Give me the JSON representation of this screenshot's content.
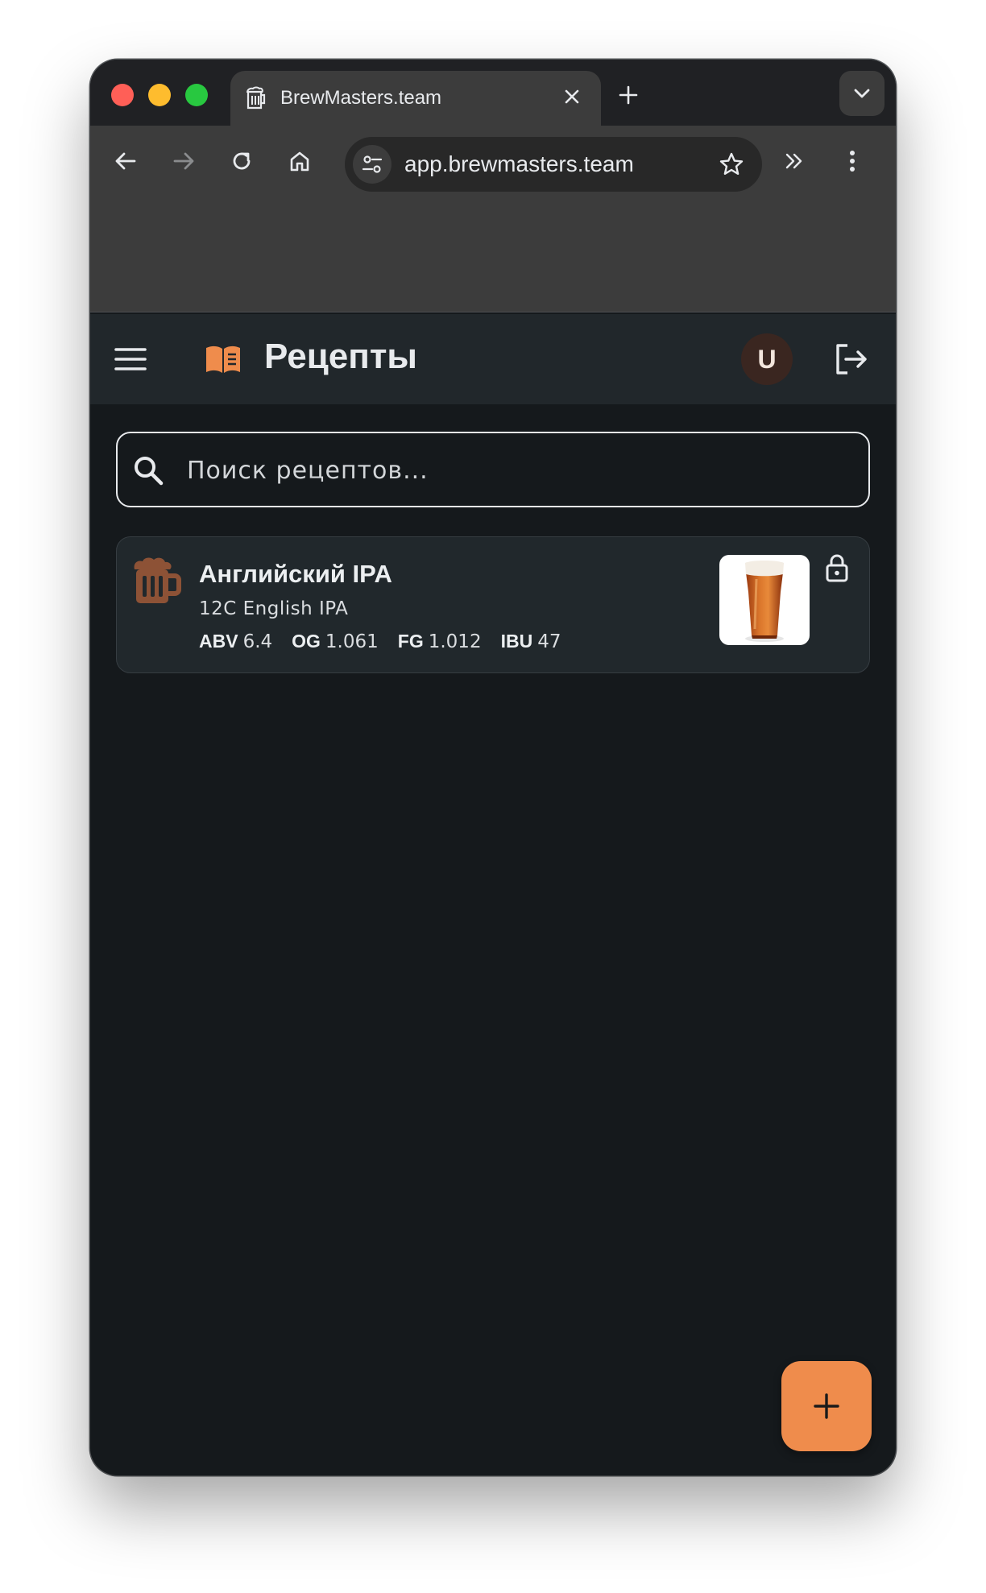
{
  "browser": {
    "tab_title": "BrewMasters.team",
    "url": "app.brewmasters.team"
  },
  "header": {
    "title": "Рецепты",
    "avatar_initial": "U"
  },
  "search": {
    "placeholder": "Поиск рецептов..."
  },
  "recipes": [
    {
      "name": "Английский IPA",
      "style": "12C English IPA",
      "stats": [
        {
          "label": "ABV",
          "value": "6.4"
        },
        {
          "label": "OG",
          "value": "1.061"
        },
        {
          "label": "FG",
          "value": "1.012"
        },
        {
          "label": "IBU",
          "value": "47"
        }
      ],
      "locked": true
    }
  ],
  "colors": {
    "accent": "#ef8c4c",
    "background": "#15191c",
    "header": "#21272b",
    "card": "#21282c",
    "avatar": "#3a2620"
  },
  "icons": {
    "tab": "beer-mug-icon",
    "menu": "hamburger-icon",
    "title": "book-icon",
    "logout": "logout-icon",
    "search": "search-icon",
    "recipe": "beer-mug-icon",
    "lock": "lock-icon",
    "fab": "plus-icon"
  }
}
